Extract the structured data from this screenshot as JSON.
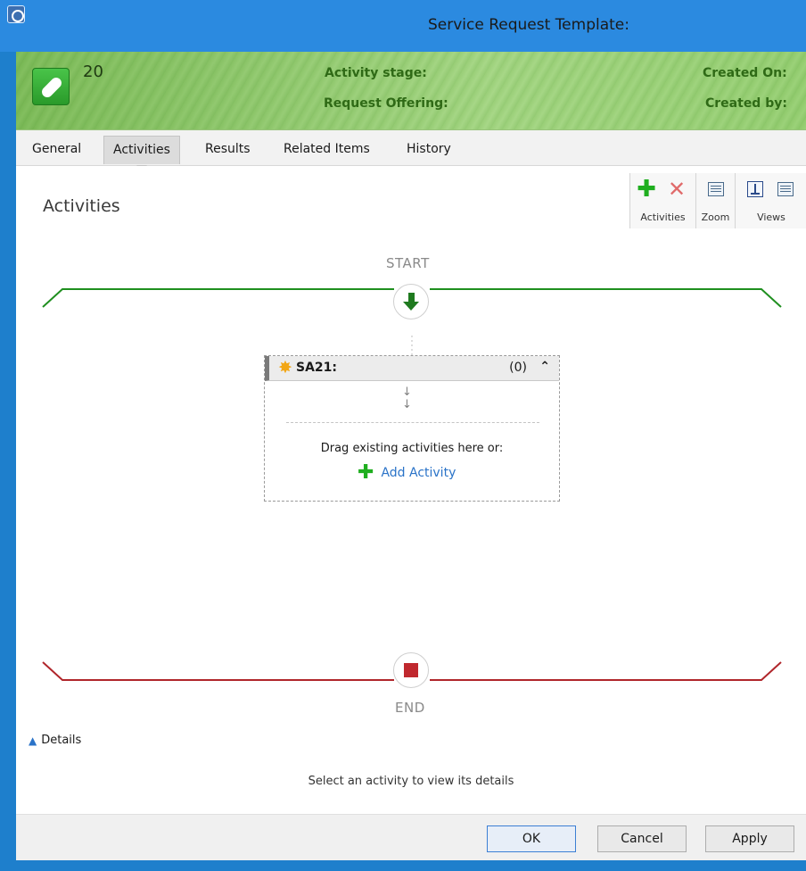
{
  "window": {
    "title": "Service Request Template:"
  },
  "header": {
    "id": "20",
    "activity_stage_label": "Activity stage:",
    "request_offering_label": "Request Offering:",
    "created_on_label": "Created On:",
    "created_by_label": "Created by:"
  },
  "tabs": [
    {
      "label": "General"
    },
    {
      "label": "Activities"
    },
    {
      "label": "Results"
    },
    {
      "label": "Related Items"
    },
    {
      "label": "History"
    }
  ],
  "active_tab": "Activities",
  "section_title": "Activities",
  "ribbon": {
    "groups": [
      {
        "label": "Activities",
        "buttons": [
          "plus-icon",
          "x-icon"
        ]
      },
      {
        "label": "Zoom",
        "buttons": [
          "zoom-icon"
        ]
      },
      {
        "label": "Views",
        "buttons": [
          "vertical-view-icon",
          "list-view-icon"
        ]
      }
    ]
  },
  "flow": {
    "start_label": "START",
    "end_label": "END",
    "start_color": "#1f8f1f",
    "end_color": "#b0262b"
  },
  "activity_card": {
    "title": "SA21:",
    "count": "(0)",
    "drag_text": "Drag existing activities here or:",
    "add_label": "Add Activity"
  },
  "details": {
    "toggle_label": "Details",
    "hint": "Select an activity to view its details"
  },
  "footer": {
    "ok": "OK",
    "cancel": "Cancel",
    "apply": "Apply"
  }
}
